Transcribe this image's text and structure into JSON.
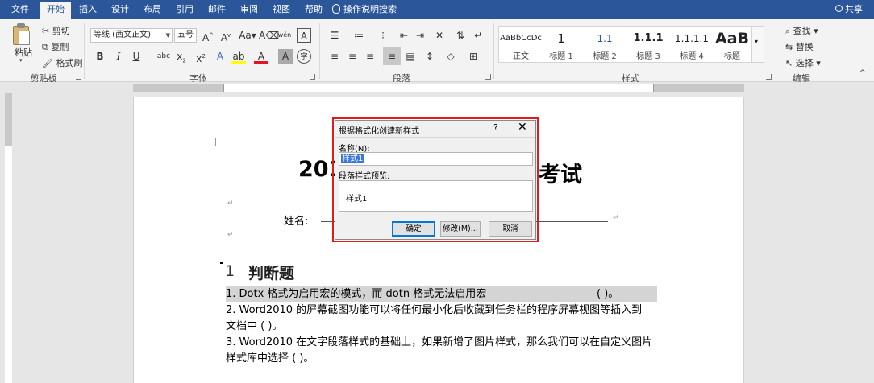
{
  "tabs": [
    {
      "label": "文件"
    },
    {
      "label": "开始"
    },
    {
      "label": "插入"
    },
    {
      "label": "设计"
    },
    {
      "label": "布局"
    },
    {
      "label": "引用"
    },
    {
      "label": "邮件"
    },
    {
      "label": "审阅"
    },
    {
      "label": "视图"
    },
    {
      "label": "帮助"
    }
  ],
  "tell_me": "操作说明搜索",
  "share": "共享",
  "ribbon": {
    "clipboard": {
      "paste": "粘贴",
      "cut": "剪切",
      "copy": "复制",
      "format_painter": "格式刷",
      "label": "剪贴板"
    },
    "font": {
      "font_name": "等线 (西文正文)",
      "font_size": "五号",
      "label": "字体"
    },
    "paragraph": {
      "label": "段落"
    },
    "styles": {
      "label": "样式",
      "items": [
        {
          "sample": "AaBbCcDc",
          "name": "正文"
        },
        {
          "sample": "1",
          "name": "标题 1"
        },
        {
          "sample": "1.1",
          "name": "标题 2"
        },
        {
          "sample": "1.1.1",
          "name": "标题 3"
        },
        {
          "sample": "1.1.1.1",
          "name": "标题 4"
        },
        {
          "sample": "AaB",
          "name": "标题"
        }
      ]
    },
    "editing": {
      "find": "查找",
      "replace": "替换",
      "select": "选择",
      "label": "编辑"
    }
  },
  "document": {
    "title_left": "201",
    "title_right": "考试",
    "name_label": "姓名:",
    "heading_num": "1",
    "heading_text": "判断题",
    "questions": [
      "1. Dotx 格式为启用宏的模式，而 dotn 格式无法启用宏",
      "2. Word2010  的屏幕截图功能可以将任何最小化后收藏到任务栏的程序屏幕视图等插入到",
      "文档中    (      )。",
      "3. Word2010 在文字段落样式的基础上，如果新增了图片样式，那么我们可以在自定义图片",
      "样式库中选择        (      )。"
    ],
    "q1_blank": "(            )。"
  },
  "dialog": {
    "title": "根据格式化创建新样式",
    "help": "?",
    "close": "✕",
    "name_label": "名称(N):",
    "name_value": "样式1",
    "preview_label": "段落样式预览:",
    "preview_text": "样式1",
    "ok": "确定",
    "modify": "修改(M)...",
    "cancel": "取消"
  }
}
